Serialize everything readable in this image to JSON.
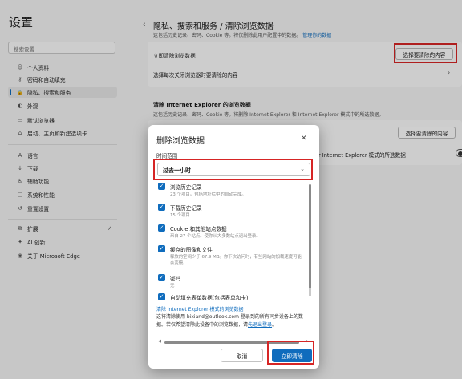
{
  "sidebar": {
    "title": "设置",
    "search_placeholder": "搜索设置",
    "items": [
      {
        "label": "个人资料",
        "icon": "profile-icon",
        "glyph": "☺"
      },
      {
        "label": "密码和自动填充",
        "icon": "key-icon",
        "glyph": "⚷"
      },
      {
        "label": "隐私、搜索和服务",
        "icon": "lock-icon",
        "glyph": "🔒",
        "active": true
      },
      {
        "label": "外观",
        "icon": "appearance-icon",
        "glyph": "◐"
      },
      {
        "label": "默认浏览器",
        "icon": "browser-icon",
        "glyph": "▭"
      },
      {
        "label": "启动、主页和新建选项卡",
        "icon": "home-icon",
        "glyph": "⌂"
      },
      {
        "label": "语言",
        "icon": "language-icon",
        "glyph": "A"
      },
      {
        "label": "下载",
        "icon": "download-icon",
        "glyph": "↓"
      },
      {
        "label": "辅助功能",
        "icon": "accessibility-icon",
        "glyph": "♿"
      },
      {
        "label": "系统和性能",
        "icon": "system-icon",
        "glyph": "▢"
      },
      {
        "label": "重置设置",
        "icon": "reset-icon",
        "glyph": "↺"
      },
      {
        "label": "扩展",
        "icon": "extensions-icon",
        "glyph": "⧉"
      },
      {
        "label": "AI 创新",
        "icon": "ai-icon",
        "glyph": "✦"
      },
      {
        "label": "关于 Microsoft Edge",
        "icon": "edge-icon",
        "glyph": "◉"
      }
    ],
    "external_icon": "↗"
  },
  "main": {
    "back_glyph": "‹",
    "title": "隐私、搜索和服务 / 清除浏览数据",
    "desc": "这包括历史记录、密码、Cookie 等。将仅删除此用户配置中的数据。",
    "desc_link": "管理你的数据",
    "row_clear_now": "立即清除浏览数据",
    "choose_button": "选择要清除的内容",
    "row_on_close": "选择每次关闭浏览器时要清除的内容",
    "chevron_glyph": "›",
    "ie_title": "清除 Internet Explorer 的浏览数据",
    "ie_desc": "这包括历史记录、密码、Cookie 等。将删除 Internet Explorer 和 Internet Explorer 模式中的所选数据。",
    "ie_choose_button": "选择要清除的内容",
    "ie_toggle_label": "r Internet Explorer 模式的所选数据",
    "ie_toggle_on": false
  },
  "dialog": {
    "title": "删除浏览数据",
    "close_glyph": "✕",
    "range_label": "时间范围",
    "range_value": "过去一小时",
    "dropdown_glyph": "⌄",
    "options": [
      {
        "label": "浏览历史记录",
        "sub": "23 个项目。包括地址栏中的自动完成。",
        "checked": true
      },
      {
        "label": "下载历史记录",
        "sub": "15 个项目",
        "checked": true
      },
      {
        "label": "Cookie 和其他站点数据",
        "sub": "来自 27 个站点。使你从大多数站点退出登录。",
        "checked": true
      },
      {
        "label": "缓存的图像和文件",
        "sub": "释放的空间少于 67.9 MB。你下次访问时，有些网站的加载速度可能会变慢。",
        "checked": true
      },
      {
        "label": "密码",
        "sub": "无",
        "checked": true
      },
      {
        "label": "自动填充表单数据(包括表单和卡)",
        "sub": "",
        "checked": true
      }
    ],
    "check_glyph": "✓",
    "ie_link": "清除 Internet Explorer 模式的浏览数据",
    "note": "这将清除使用 bixiand@outlook.com 登录到的所有同步设备上的数据。若仅希望清除此设备中的浏览数据，请",
    "note_link": "先退出登录",
    "note_end": "。",
    "cancel_button": "取消",
    "confirm_button": "立即清除"
  },
  "colors": {
    "accent": "#0f6cbd",
    "highlight": "#d62525"
  }
}
